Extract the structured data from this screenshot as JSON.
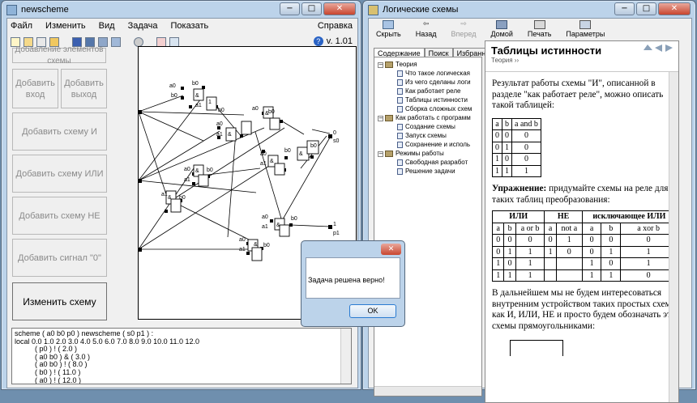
{
  "left_window": {
    "title": "newscheme",
    "menu": [
      "Файл",
      "Изменить",
      "Вид",
      "Задача",
      "Показать"
    ],
    "menu_help": "Справка",
    "version": "v. 1.01",
    "panel_header": "Добавление элементов схемы",
    "buttons": {
      "add_input": "Добавить вход",
      "add_output": "Добавить выход",
      "add_and": "Добавить схему И",
      "add_or": "Добавить схему ИЛИ",
      "add_not": "Добавить схему НЕ",
      "add_zero": "Добавить сигнал \"0\"",
      "edit_scheme": "Изменить схему"
    },
    "code_lines": [
      "scheme ( a0 b0 p0 ) newscheme ( s0 p1 ) :",
      "local 0.0 1.0 2.0 3.0 4.0 5.0 6.0 7.0 8.0 9.0 10.0 11.0 12.0",
      "          ( p0 ) ! ( 2.0 )",
      "          ( a0 b0 ) & ( 3.0 )",
      "          ( a0 b0 ) ! ( 8.0 )",
      "          ( b0 ) ! ( 11.0 )",
      "          ( a0 ) ! ( 12.0 )"
    ],
    "canvas_labels": {
      "a0": "a0",
      "b0": "b0",
      "p0": "p0",
      "s0": "s0",
      "p1": "p1",
      "one": "1",
      "zero": "0",
      "and": "&",
      "not": "1"
    }
  },
  "right_window": {
    "title": "Логические схемы",
    "toolbar": [
      "Скрыть",
      "Назад",
      "Вперед",
      "Домой",
      "Печать",
      "Параметры"
    ],
    "tabs": [
      "Содержание",
      "Поиск",
      "Избранное"
    ],
    "tree": [
      {
        "level": 0,
        "kind": "book",
        "toggle": "−",
        "label": "Теория"
      },
      {
        "level": 1,
        "kind": "page",
        "label": "Что такое логическая"
      },
      {
        "level": 1,
        "kind": "page",
        "label": "Из чего сделаны логи"
      },
      {
        "level": 1,
        "kind": "page",
        "label": "Как работает реле"
      },
      {
        "level": 1,
        "kind": "page",
        "label": "Таблицы истинности"
      },
      {
        "level": 1,
        "kind": "page",
        "label": "Сборка сложных схем"
      },
      {
        "level": 0,
        "kind": "book",
        "toggle": "−",
        "label": "Как работать с программ"
      },
      {
        "level": 1,
        "kind": "page",
        "label": "Создание схемы"
      },
      {
        "level": 1,
        "kind": "page",
        "label": "Запуск схемы"
      },
      {
        "level": 1,
        "kind": "page",
        "label": "Сохранение и исполь"
      },
      {
        "level": 0,
        "kind": "book",
        "toggle": "−",
        "label": "Режимы работы"
      },
      {
        "level": 1,
        "kind": "page",
        "label": "Свободная разработ"
      },
      {
        "level": 1,
        "kind": "page",
        "label": "Решение задачи"
      }
    ],
    "doc": {
      "title": "Таблицы истинности",
      "breadcrumb": "Теория ››",
      "para1": "Результат работы схемы \"И\", описанной в разделе \"как работает реле\", можно описать такой таблицей:",
      "and_table": {
        "header": [
          "a",
          "b",
          "a and b"
        ],
        "rows": [
          [
            "0",
            "0",
            "0"
          ],
          [
            "0",
            "1",
            "0"
          ],
          [
            "1",
            "0",
            "0"
          ],
          [
            "1",
            "1",
            "1"
          ]
        ]
      },
      "exercise_bold": "Упражнение:",
      "exercise_text": " придумайте схемы на реле для таких таблиц преобразования:",
      "multi_table": {
        "groups": [
          "ИЛИ",
          "НЕ",
          "исключающее ИЛИ"
        ],
        "header": [
          "a",
          "b",
          "a or b",
          "a",
          "not a",
          "a",
          "b",
          "a xor b"
        ],
        "rows": [
          [
            "0",
            "0",
            "0",
            "0",
            "1",
            "0",
            "0",
            "0"
          ],
          [
            "0",
            "1",
            "1",
            "1",
            "0",
            "0",
            "1",
            "1"
          ],
          [
            "1",
            "0",
            "1",
            "",
            "",
            "1",
            "0",
            "1"
          ],
          [
            "1",
            "1",
            "1",
            "",
            "",
            "1",
            "1",
            "0"
          ]
        ]
      },
      "para2": "В дальнейшем мы не будем интересоваться внутренним устройством таких простых схем как И, ИЛИ, НЕ и просто будем обозначать эти схемы прямоугольниками:"
    }
  },
  "dialog": {
    "message": "Задача решена верно!",
    "ok": "OK",
    "close": "✕"
  },
  "caption_buttons": {
    "min": "−",
    "max": "□",
    "close": "✕"
  }
}
